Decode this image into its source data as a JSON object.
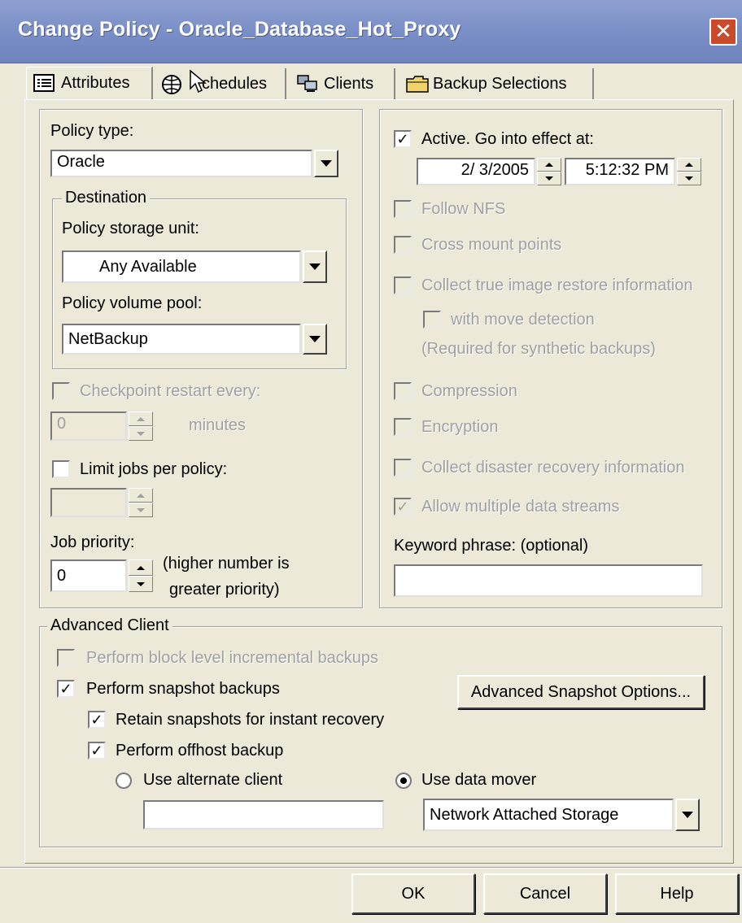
{
  "window": {
    "title": "Change Policy - Oracle_Database_Hot_Proxy",
    "close_glyph": "✕"
  },
  "tabs": [
    {
      "label": "Attributes",
      "icon": "list-icon",
      "active": true
    },
    {
      "label": "Schedules",
      "icon": "clock-globe-icon",
      "active": false,
      "obscured_label": "chedules"
    },
    {
      "label": "Clients",
      "icon": "computers-icon",
      "active": false
    },
    {
      "label": "Backup Selections",
      "icon": "folder-icon",
      "active": false
    }
  ],
  "left": {
    "policy_type_label": "Policy type:",
    "policy_type_value": "Oracle",
    "destination": {
      "legend": "Destination",
      "storage_unit_label": "Policy storage unit:",
      "storage_unit_value": "Any Available",
      "volume_pool_label": "Policy volume pool:",
      "volume_pool_value": "NetBackup"
    },
    "checkpoint_label": "Checkpoint restart every:",
    "checkpoint_value": "0",
    "checkpoint_unit": "minutes",
    "limit_jobs_label": "Limit jobs per policy:",
    "limit_jobs_value": "",
    "job_priority_label": "Job priority:",
    "job_priority_value": "0",
    "job_priority_hint_line1": "(higher number is",
    "job_priority_hint_line2": "greater priority)"
  },
  "right": {
    "active_label": "Active. Go into effect at:",
    "active_date": "2/ 3/2005",
    "active_time": "5:12:32 PM",
    "follow_nfs_label": "Follow NFS",
    "cross_mount_label": "Cross mount points",
    "true_image_label": "Collect true image restore information",
    "move_detection_label": "with move detection",
    "synthetic_note": "(Required for synthetic backups)",
    "compression_label": "Compression",
    "encryption_label": "Encryption",
    "disaster_label": "Collect disaster recovery information",
    "multi_streams_label": "Allow multiple data streams",
    "keyword_label": "Keyword phrase: (optional)",
    "keyword_value": ""
  },
  "advanced": {
    "legend": "Advanced Client",
    "block_level_label": "Perform block level incremental backups",
    "snapshot_label": "Perform snapshot backups",
    "snapshot_options_button": "Advanced Snapshot Options...",
    "retain_label": "Retain snapshots for instant recovery",
    "offhost_label": "Perform offhost backup",
    "alt_client_label": "Use alternate client",
    "alt_client_value": "",
    "data_mover_label": "Use data mover",
    "data_mover_value": "Network Attached Storage"
  },
  "buttons": {
    "ok": "OK",
    "cancel": "Cancel",
    "help": "Help"
  },
  "checks": {
    "checked_glyph": "✓"
  },
  "colors": {
    "titlebar": "#7a8fc7",
    "face": "#ece9d8",
    "close": "#c94b2b",
    "disabled_text": "#a0a0a0"
  }
}
